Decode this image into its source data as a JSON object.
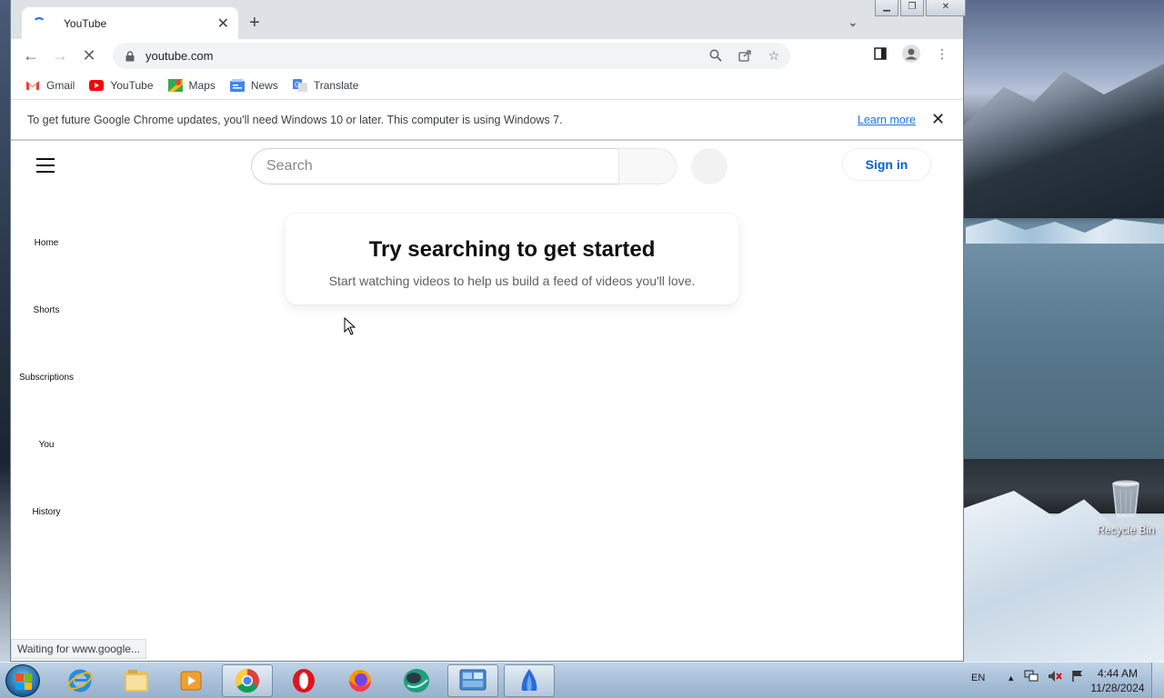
{
  "browser": {
    "tab": {
      "title": "YouTube"
    },
    "address": {
      "url": "youtube.com"
    },
    "bookmarks": [
      {
        "label": "Gmail"
      },
      {
        "label": "YouTube"
      },
      {
        "label": "Maps"
      },
      {
        "label": "News"
      },
      {
        "label": "Translate"
      }
    ],
    "infobar": {
      "message": "To get future Google Chrome updates, you'll need Windows 10 or later. This computer is using Windows 7.",
      "learn_more": "Learn more"
    },
    "status": "Waiting for www.google..."
  },
  "youtube": {
    "search_placeholder": "Search",
    "sign_in": "Sign in",
    "nav": [
      {
        "label": "Home"
      },
      {
        "label": "Shorts"
      },
      {
        "label": "Subscriptions"
      },
      {
        "label": "You"
      },
      {
        "label": "History"
      }
    ],
    "empty_state": {
      "title": "Try searching to get started",
      "subtitle": "Start watching videos to help us build a feed of videos you'll love."
    }
  },
  "desktop": {
    "recycle_bin": "Recycle Bin"
  },
  "taskbar": {
    "language": "EN",
    "time": "4:44 AM",
    "date": "11/28/2024",
    "apps": [
      {
        "icon": "internet-explorer-icon"
      },
      {
        "icon": "file-explorer-icon"
      },
      {
        "icon": "media-player-icon"
      },
      {
        "icon": "chrome-icon",
        "active": true
      },
      {
        "icon": "opera-icon"
      },
      {
        "icon": "firefox-icon"
      },
      {
        "icon": "green-orb-icon"
      },
      {
        "icon": "control-panel-icon",
        "active": true
      },
      {
        "icon": "blue-app-icon",
        "active": true
      }
    ]
  },
  "colors": {
    "chrome_blue": "#1a73e8",
    "youtube_red": "#ff0000",
    "signin_blue": "#065fd4"
  }
}
